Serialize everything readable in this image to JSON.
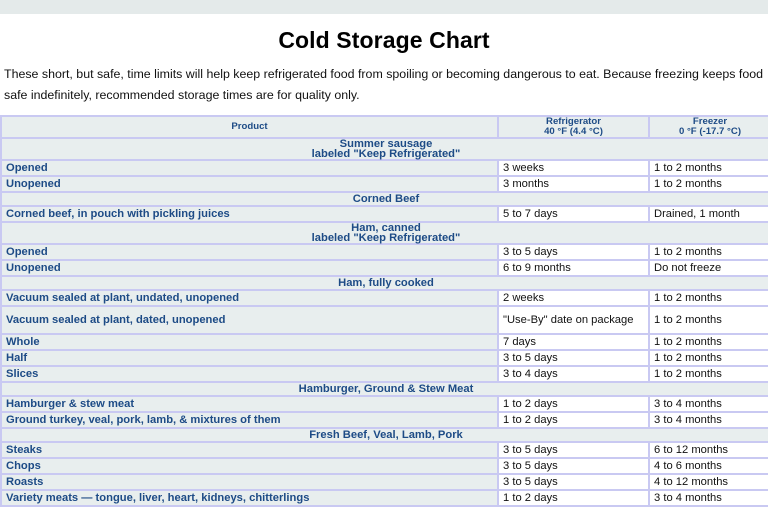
{
  "page": {
    "title": "Cold Storage Chart",
    "intro": "These short, but safe, time limits will help keep refrigerated food from spoiling or becoming dangerous to eat. Because freezing keeps food safe indefinitely, recommended storage times are for quality only."
  },
  "table": {
    "headers": {
      "product": "Product",
      "refrigerator_line1": "Refrigerator",
      "refrigerator_line2": "40 °F (4.4 °C)",
      "freezer_line1": "Freezer",
      "freezer_line2": "0 °F (-17.7 °C)"
    },
    "groups": [
      {
        "title_line1": "Summer sausage",
        "title_line2": "labeled \"Keep Refrigerated\"",
        "rows": [
          {
            "product": "Opened",
            "refrigerator": "3 weeks",
            "freezer": "1 to 2 months"
          },
          {
            "product": "Unopened",
            "refrigerator": "3 months",
            "freezer": "1 to 2 months"
          }
        ]
      },
      {
        "title_line1": "Corned Beef",
        "rows": [
          {
            "product": "Corned beef, in pouch with pickling juices",
            "refrigerator": "5 to 7 days",
            "freezer": "Drained, 1 month"
          }
        ]
      },
      {
        "title_line1": "Ham, canned",
        "title_line2": "labeled \"Keep Refrigerated\"",
        "rows": [
          {
            "product": "Opened",
            "refrigerator": "3 to 5 days",
            "freezer": "1 to 2 months"
          },
          {
            "product": "Unopened",
            "refrigerator": "6 to 9 months",
            "freezer": "Do not freeze"
          }
        ]
      },
      {
        "title_line1": "Ham, fully cooked",
        "rows": [
          {
            "product": "Vacuum sealed at plant, undated, unopened",
            "refrigerator": "2 weeks",
            "freezer": "1 to 2 months"
          },
          {
            "product": "Vacuum sealed at plant, dated, unopened",
            "refrigerator": "\"Use-By\" date on package",
            "freezer": "1 to 2 months"
          },
          {
            "product": "Whole",
            "refrigerator": "7 days",
            "freezer": "1 to 2 months"
          },
          {
            "product": "Half",
            "refrigerator": "3 to 5 days",
            "freezer": "1 to 2 months"
          },
          {
            "product": "Slices",
            "refrigerator": "3 to 4 days",
            "freezer": "1 to 2 months"
          }
        ]
      },
      {
        "title_line1": "Hamburger, Ground & Stew Meat",
        "rows": [
          {
            "product": "Hamburger & stew meat",
            "refrigerator": "1 to 2 days",
            "freezer": "3 to 4 months"
          },
          {
            "product": "Ground turkey, veal, pork, lamb, & mixtures of them",
            "refrigerator": "1 to 2 days",
            "freezer": "3 to 4 months"
          }
        ]
      },
      {
        "title_line1": "Fresh Beef, Veal, Lamb, Pork",
        "rows": [
          {
            "product": "Steaks",
            "refrigerator": "3 to 5 days",
            "freezer": "6 to 12 months"
          },
          {
            "product": "Chops",
            "refrigerator": "3 to 5 days",
            "freezer": "4 to 6 months"
          },
          {
            "product": "Roasts",
            "refrigerator": "3 to 5 days",
            "freezer": "4 to 12 months"
          },
          {
            "product": "Variety meats — tongue, liver, heart, kidneys, chitterlings",
            "refrigerator": "1 to 2 days",
            "freezer": "3 to 4 months"
          }
        ]
      }
    ]
  },
  "colors": {
    "label_text": "#1d4b86",
    "label_background": "#e8eeee",
    "border": "#c9c9f2",
    "top_strip": "#e4eaea"
  }
}
